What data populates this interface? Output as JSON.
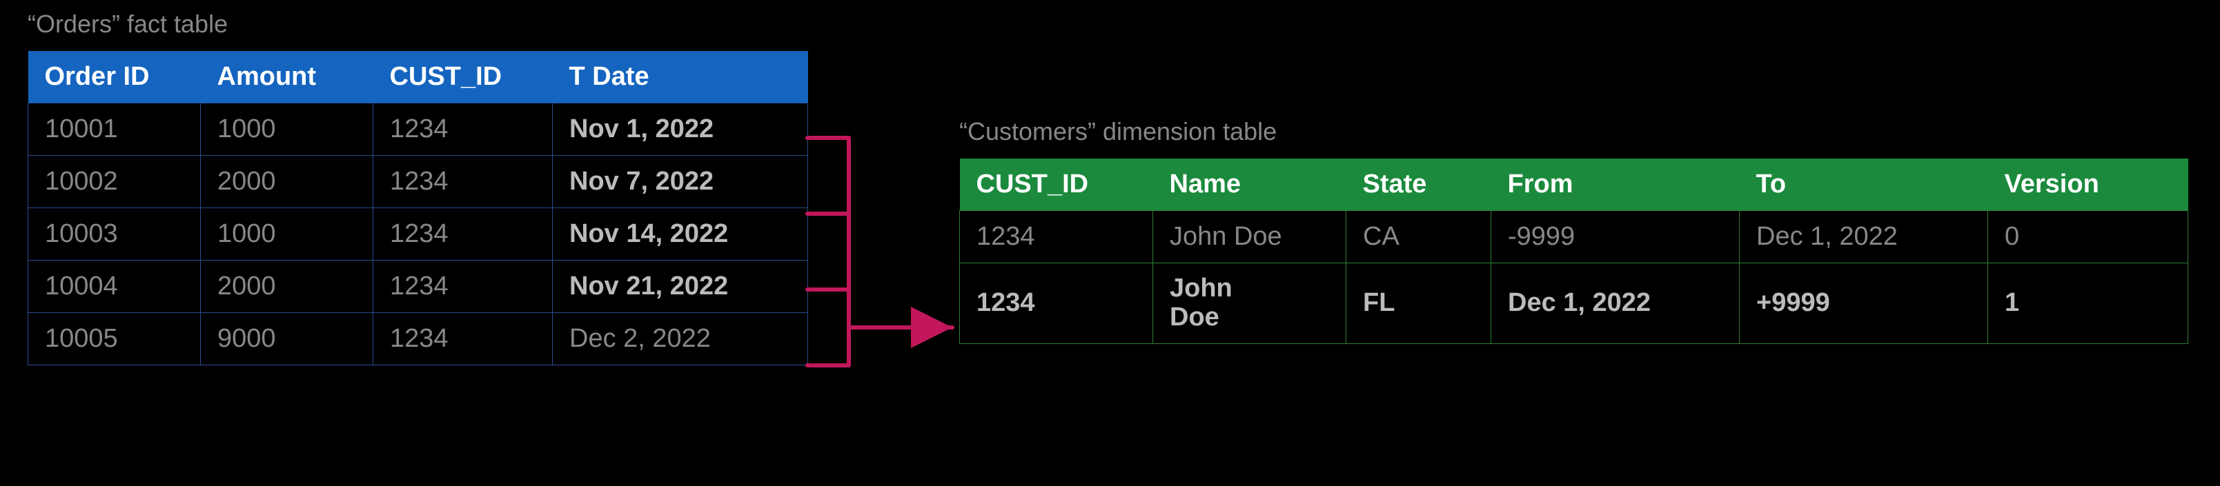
{
  "orders": {
    "caption": "“Orders” fact table",
    "columns": [
      "Order ID",
      "Amount",
      "CUST_ID",
      "T Date"
    ],
    "rows": [
      {
        "order_id": "10001",
        "amount": "1000",
        "cust_id": "1234",
        "t_date": "Nov 1, 2022",
        "date_bold": true
      },
      {
        "order_id": "10002",
        "amount": "2000",
        "cust_id": "1234",
        "t_date": "Nov 7, 2022",
        "date_bold": true
      },
      {
        "order_id": "10003",
        "amount": "1000",
        "cust_id": "1234",
        "t_date": "Nov 14, 2022",
        "date_bold": true
      },
      {
        "order_id": "10004",
        "amount": "2000",
        "cust_id": "1234",
        "t_date": "Nov 21, 2022",
        "date_bold": true
      },
      {
        "order_id": "10005",
        "amount": "9000",
        "cust_id": "1234",
        "t_date": "Dec 2, 2022",
        "date_bold": false
      }
    ]
  },
  "customers": {
    "caption": "“Customers” dimension table",
    "columns": [
      "CUST_ID",
      "Name",
      "State",
      "From",
      "To",
      "Version"
    ],
    "rows": [
      {
        "cust_id": "1234",
        "name": "John Doe",
        "state": "CA",
        "from": "-9999",
        "to": "Dec 1, 2022",
        "version": "0",
        "bold": false,
        "wrap_name": false
      },
      {
        "cust_id": "1234",
        "name": "John Doe",
        "state": "FL",
        "from": "Dec 1, 2022",
        "to": "+9999",
        "version": "1",
        "bold": true,
        "wrap_name": true
      }
    ]
  },
  "arrow_color": "#c2185b"
}
